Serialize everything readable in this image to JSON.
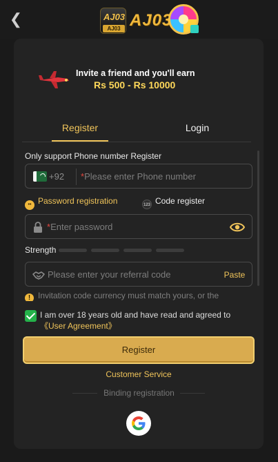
{
  "header": {
    "back_icon": "chevron-left-icon",
    "logo_badge_top": "AJ03",
    "logo_badge_bottom": "AJ03",
    "logo_text": "AJ03"
  },
  "banner": {
    "line1": "Invite a friend and you'll earn",
    "line2": "Rs 500 - Rs 10000"
  },
  "tabs": {
    "register": "Register",
    "login": "Login",
    "active": "register"
  },
  "form": {
    "support_note": "Only support Phone number Register",
    "phone": {
      "country_prefix": "+92",
      "placeholder": "Please enter Phone number",
      "required_mark": "*"
    },
    "options": {
      "password": "Password registration",
      "code": "Code register",
      "code_icon_text": "123",
      "selected": "password"
    },
    "password": {
      "placeholder": "Enter password",
      "required_mark": "*"
    },
    "strength": {
      "label": "Strength",
      "level": 0
    },
    "referral": {
      "placeholder": "Please enter your referral code",
      "paste_label": "Paste"
    },
    "notice": "Invitation code currency must match yours, or the",
    "agreement": {
      "checked": true,
      "text": "I am over 18 years old and have read and agreed to",
      "link": "《User Agreement》"
    },
    "submit_label": "Register"
  },
  "footer": {
    "customer_service": "Customer Service",
    "binding_label": "Binding registration"
  },
  "colors": {
    "accent": "#f0c45a",
    "button": "#d9ab4f",
    "card": "#232323",
    "check": "#24b24a"
  }
}
